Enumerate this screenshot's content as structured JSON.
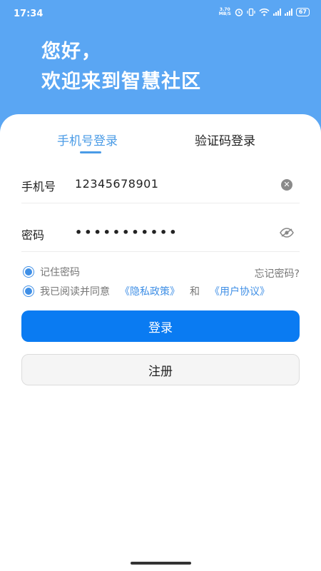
{
  "status_bar": {
    "time": "17:34",
    "net_speed_top": "3.70",
    "net_speed_bottom": "MB/S",
    "battery": "67"
  },
  "hero": {
    "line1": "您好，",
    "line2": "欢迎来到智慧社区",
    "background": "#5aa6f3"
  },
  "tabs": [
    {
      "label": "手机号登录",
      "active": true
    },
    {
      "label": "验证码登录",
      "active": false
    }
  ],
  "form": {
    "phone": {
      "label": "手机号",
      "value": "12345678901"
    },
    "password": {
      "label": "密码",
      "value": "•••••••••••"
    }
  },
  "options": {
    "remember": {
      "label": "记住密码",
      "checked": true
    },
    "forgot": "忘记密码?",
    "agree": {
      "prefix": "我已阅读并同意",
      "privacy": "《隐私政策》",
      "and": "和",
      "terms": "《用户协议》",
      "checked": true
    }
  },
  "buttons": {
    "login": "登录",
    "register": "注册"
  },
  "colors": {
    "accent": "#0a7bf2",
    "link": "#3f8fe6"
  }
}
